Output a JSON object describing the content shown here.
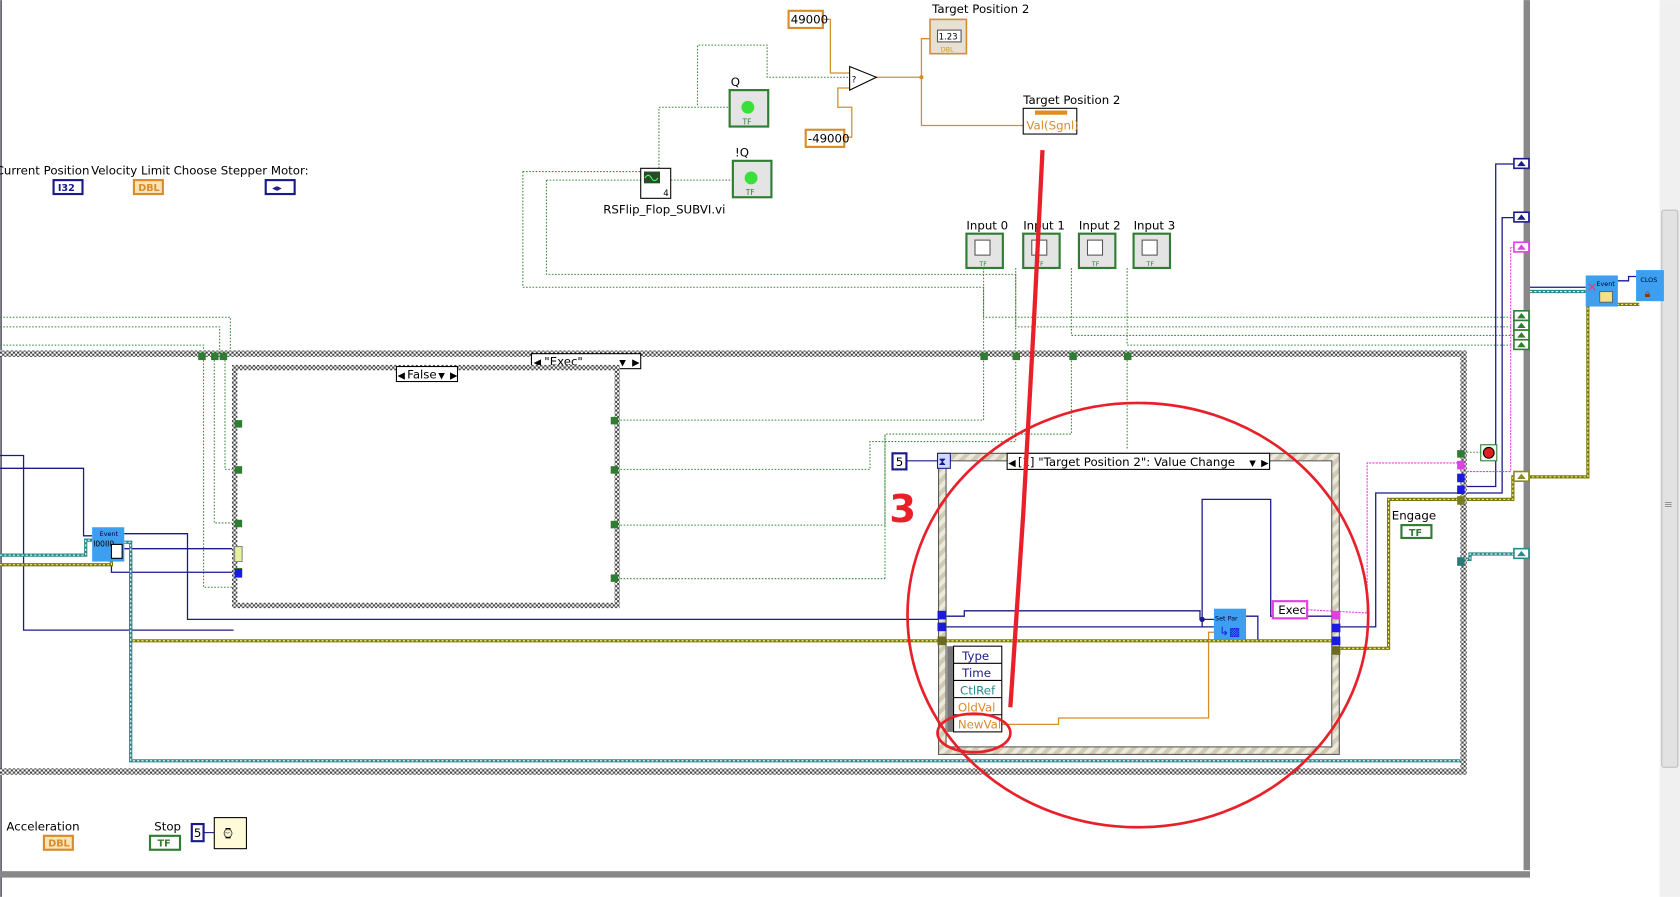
{
  "controls_top_left": [
    {
      "label": "Current Position",
      "type": "I32"
    },
    {
      "label": "Velocity Limit",
      "type": "DBL"
    },
    {
      "label": "Choose Stepper Motor:",
      "type": "enum"
    }
  ],
  "constants": {
    "pos_max": "49000",
    "pos_min": "-49000",
    "timeout": "5",
    "wait_ms": "5",
    "exec": "Exec"
  },
  "indicator": {
    "label": "Target Position  2",
    "value": "1.23",
    "type": "DBL"
  },
  "property_node": {
    "label": "Target Position  2",
    "property": "Val(Sgnl)"
  },
  "leds": [
    {
      "label": "Q",
      "type": "TF"
    },
    {
      "label": "!Q",
      "type": "TF"
    }
  ],
  "subvi": {
    "label": "RSFlip_Flop_SUBVI.vi",
    "badge": "4"
  },
  "inputs": [
    {
      "label": "Input 0",
      "type": "TF"
    },
    {
      "label": "Input 1",
      "type": "TF"
    },
    {
      "label": "Input 2",
      "type": "TF"
    },
    {
      "label": "Input 3",
      "type": "TF"
    }
  ],
  "case_outer": {
    "selector": "\"Exec\""
  },
  "case_inner": {
    "selector": "False"
  },
  "event_structure": {
    "selector": "[1] \"Target Position  2\": Value Change",
    "event_data": [
      "Type",
      "Time",
      "CtlRef",
      "OldVal",
      "NewVal"
    ]
  },
  "nodes": {
    "set_par": "Set Par",
    "event_left": "Event",
    "event_destroy": "Event",
    "close": "CLOS"
  },
  "annotation": {
    "number": "3",
    "color": "#e8202a"
  },
  "bottom_controls": [
    {
      "label": "Acceleration",
      "type": "DBL"
    },
    {
      "label": "Stop",
      "type": "TF"
    }
  ],
  "engage": {
    "label": "Engage",
    "type": "TF"
  },
  "colors": {
    "orange": "#d98c2a",
    "blue": "#1a1a8c",
    "green": "#2e7d32",
    "pink": "#e040e0",
    "teal": "#2a8a8a",
    "olive": "#8a8a20"
  }
}
